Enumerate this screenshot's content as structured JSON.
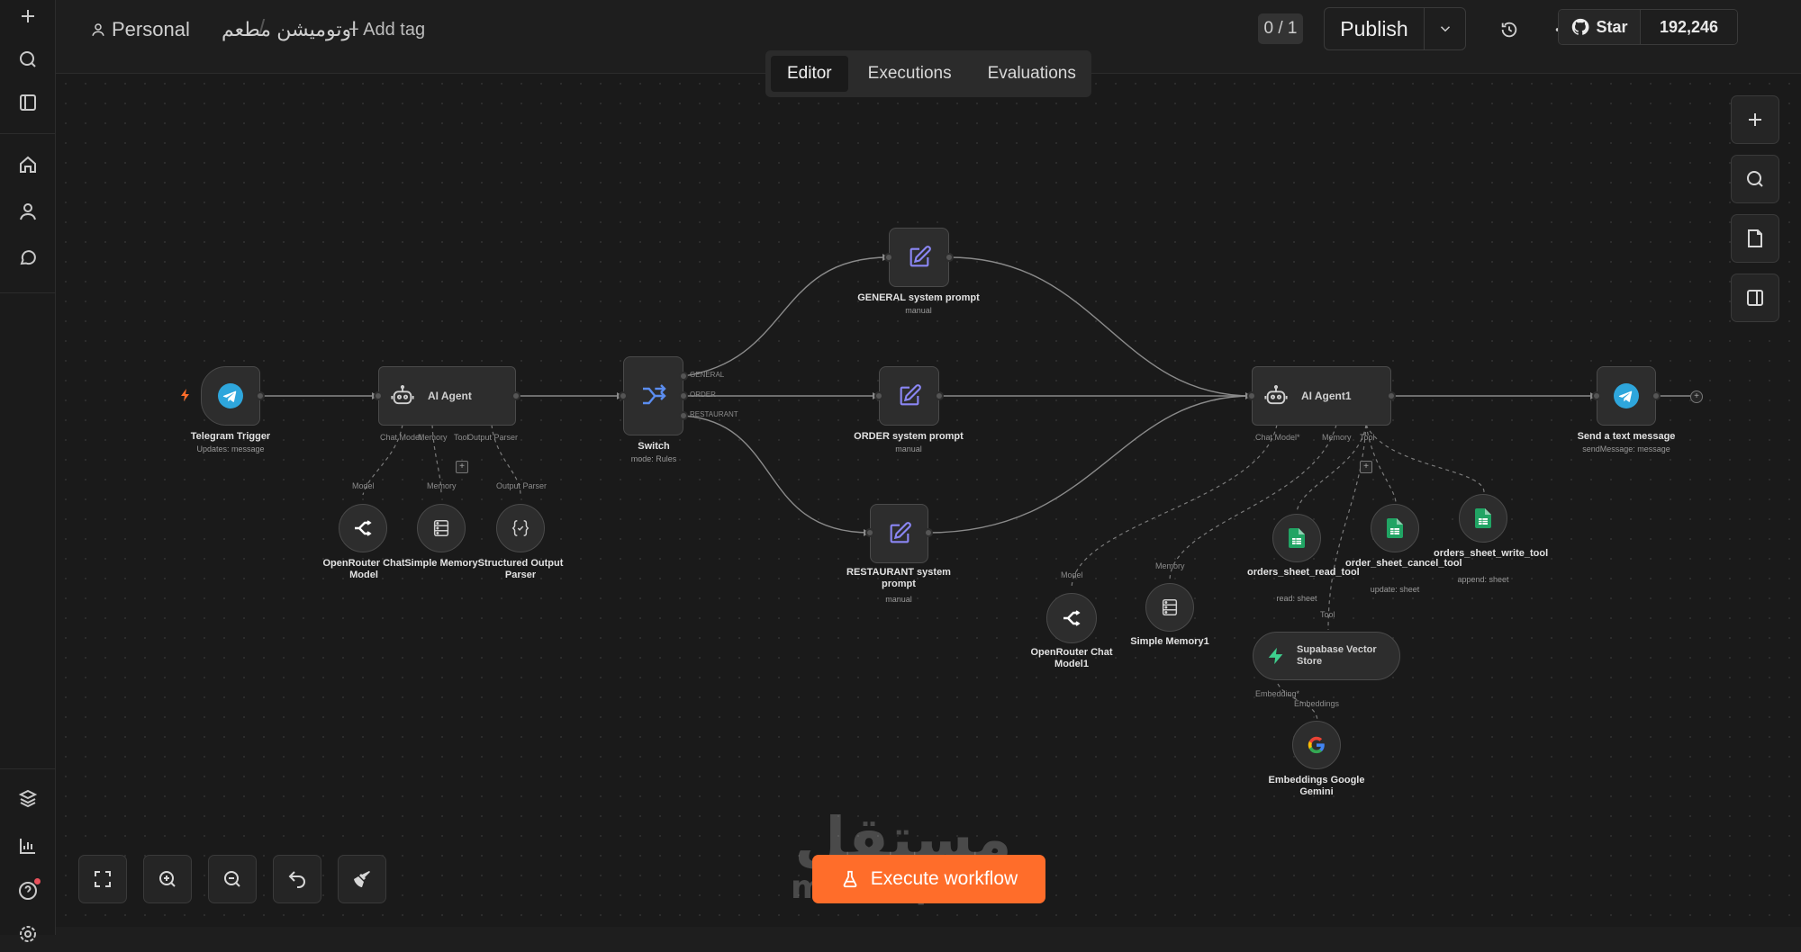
{
  "header": {
    "workspace": "Personal",
    "workflow_name": "اوتوميشن مطعم",
    "add_tag": "+ Add tag",
    "counter": "0 / 1",
    "publish_label": "Publish",
    "github_star": "Star",
    "github_count": "192,246"
  },
  "tabs": [
    {
      "label": "Editor",
      "active": true
    },
    {
      "label": "Executions",
      "active": false
    },
    {
      "label": "Evaluations",
      "active": false
    }
  ],
  "sidebar": {
    "icons": [
      "plus-icon",
      "search-icon",
      "panel-icon",
      "home-icon",
      "user-icon",
      "chat-icon",
      "templates-icon",
      "insights-icon",
      "help-icon",
      "settings-icon"
    ]
  },
  "nodes": {
    "telegram_trigger": {
      "title": "Telegram Trigger",
      "sub": "Updates: message"
    },
    "ai_agent": {
      "title": "AI Agent",
      "ports": [
        "Chat Model",
        "Memory",
        "Tool",
        "Output Parser"
      ]
    },
    "openrouter": {
      "title": "OpenRouter Chat Model",
      "port": "Model"
    },
    "simple_memory": {
      "title": "Simple Memory",
      "port": "Memory"
    },
    "output_parser": {
      "title": "Structured Output Parser",
      "port": "Output Parser"
    },
    "switch": {
      "title": "Switch",
      "sub": "mode: Rules",
      "outputs": [
        "GENERAL",
        "ORDER",
        "RESTAURANT"
      ]
    },
    "general_prompt": {
      "title": "GENERAL system prompt",
      "sub": "manual"
    },
    "order_prompt": {
      "title": "ORDER system prompt",
      "sub": "manual"
    },
    "restaurant_prompt": {
      "title": "RESTAURANT system prompt",
      "sub": "manual"
    },
    "ai_agent1": {
      "title": "AI Agent1",
      "ports": [
        "Chat Model*",
        "Memory",
        "Tool"
      ]
    },
    "openrouter1": {
      "title": "OpenRouter Chat Model1",
      "port": "Model"
    },
    "simple_memory1": {
      "title": "Simple Memory1",
      "port": "Memory"
    },
    "read_tool": {
      "title": "orders_sheet_read_tool",
      "sub": "read: sheet"
    },
    "cancel_tool": {
      "title": "order_sheet_cancel_tool",
      "sub": "update: sheet"
    },
    "write_tool": {
      "title": "orders_sheet_write_tool",
      "sub": "append: sheet"
    },
    "supabase": {
      "title": "Supabase Vector Store",
      "port_top": "Tool",
      "port_bottom": "Embedding*"
    },
    "embeddings": {
      "title": "Embeddings Google Gemini",
      "port": "Embeddings"
    },
    "send_message": {
      "title": "Send a text message",
      "sub": "sendMessage: message"
    }
  },
  "execute_label": "Execute workflow",
  "watermark": {
    "arabic": "مستقل",
    "latin": "mostaql.com"
  },
  "colors": {
    "accent": "#ff6d2a",
    "telegram": "#2ea6dc",
    "sheets": "#21a464",
    "supabase": "#3ecf8e",
    "prompt": "#8b87f5",
    "switch": "#5b8def"
  }
}
